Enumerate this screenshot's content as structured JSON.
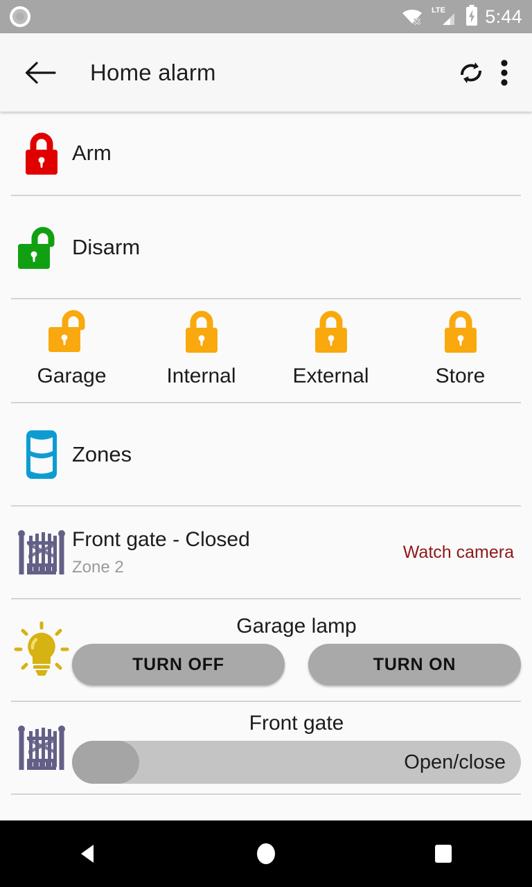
{
  "status_bar": {
    "recording_icon": "screen-record-icon",
    "wifi_icon": "wifi-disconnected-icon",
    "network_label": "LTE",
    "signal_icon": "cellular-signal-icon",
    "battery_icon": "battery-charging-icon",
    "time": "5:44"
  },
  "toolbar": {
    "back_icon": "arrow-back-icon",
    "title": "Home alarm",
    "refresh_icon": "refresh-icon",
    "menu_icon": "overflow-menu-icon"
  },
  "list": {
    "arm": {
      "label": "Arm",
      "icon": "lock-closed-icon",
      "color": "#e00000"
    },
    "disarm": {
      "label": "Disarm",
      "icon": "lock-open-icon",
      "color": "#11a011"
    },
    "zone_locks": {
      "color": "#f9a90d",
      "items": [
        {
          "label": "Garage",
          "icon": "lock-open-icon",
          "state": "unlocked"
        },
        {
          "label": "Internal",
          "icon": "lock-closed-icon",
          "state": "locked"
        },
        {
          "label": "External",
          "icon": "lock-closed-icon",
          "state": "locked"
        },
        {
          "label": "Store",
          "icon": "lock-closed-icon",
          "state": "locked"
        }
      ]
    },
    "zones": {
      "label": "Zones",
      "icon": "zones-icon",
      "color": "#0d9cd1"
    },
    "front_gate_status": {
      "title": "Front gate - Closed",
      "subtitle": "Zone 2",
      "action": "Watch camera",
      "action_color": "#8d1a18",
      "icon": "gate-icon",
      "icon_color": "#636087"
    },
    "garage_lamp": {
      "title": "Garage lamp",
      "icon": "lightbulb-icon",
      "icon_color": "#d6b212",
      "turn_off_label": "TURN OFF",
      "turn_on_label": "TURN ON"
    },
    "front_gate_slider": {
      "title": "Front gate",
      "icon": "gate-icon",
      "icon_color": "#636087",
      "slider_label": "Open/close"
    }
  },
  "nav_bar": {
    "back": "nav-back-icon",
    "home": "nav-home-icon",
    "recents": "nav-recents-icon"
  }
}
